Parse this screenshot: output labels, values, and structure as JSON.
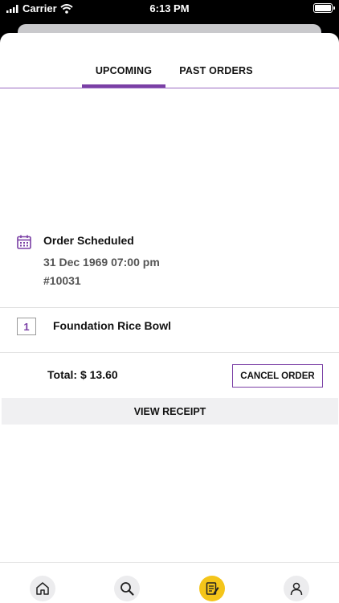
{
  "status_bar": {
    "carrier": "Carrier",
    "time": "6:13 PM"
  },
  "tabs": [
    {
      "label": "UPCOMING",
      "active": true
    },
    {
      "label": "PAST ORDERS",
      "active": false
    }
  ],
  "order": {
    "status": "Order Scheduled",
    "date": "31 Dec 1969 07:00 pm",
    "number": "#10031",
    "items": [
      {
        "quantity": "1",
        "name": "Foundation Rice Bowl"
      }
    ],
    "total": "Total: $ 13.60",
    "cancel_label": "CANCEL ORDER",
    "receipt_label": "VIEW RECEIPT"
  },
  "bottom_nav": [
    {
      "icon": "home-icon"
    },
    {
      "icon": "search-icon"
    },
    {
      "icon": "orders-icon",
      "active": true
    },
    {
      "icon": "profile-icon"
    }
  ],
  "colors": {
    "accent": "#7a3fa5",
    "active_nav": "#f4c51a"
  }
}
